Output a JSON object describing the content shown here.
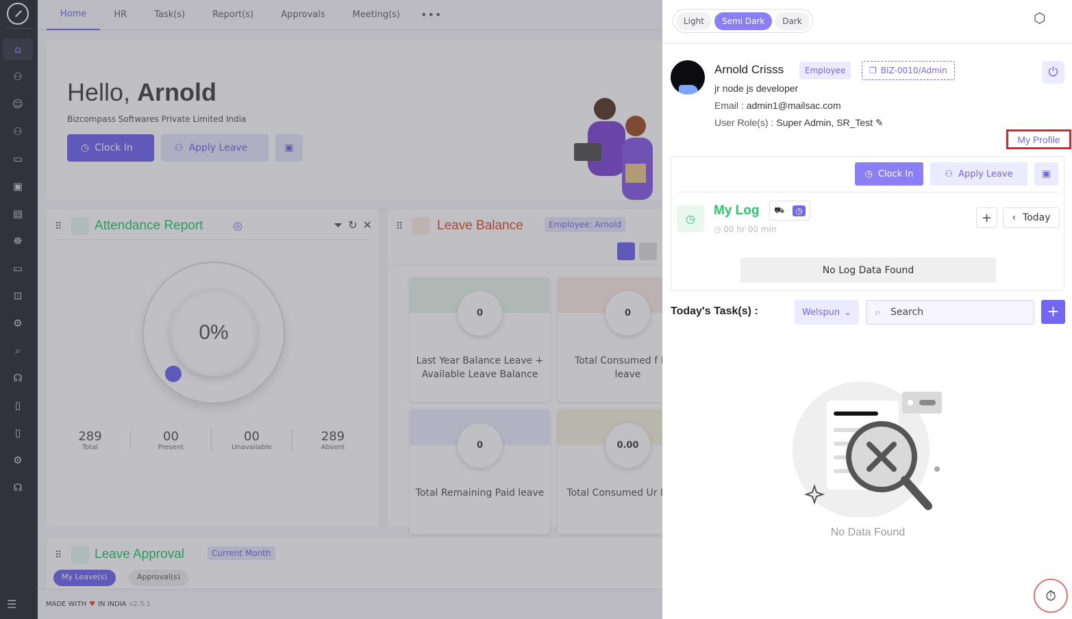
{
  "nav": {
    "tabs": [
      "Home",
      "HR",
      "Task(s)",
      "Report(s)",
      "Approvals",
      "Meeting(s)"
    ],
    "more": "•••"
  },
  "hero": {
    "hello_prefix": "Hello,",
    "hello_name": "Arnold",
    "company": "Bizcompass Softwares Private Limited India",
    "clock_in": "Clock In",
    "apply_leave": "Apply Leave"
  },
  "attendance": {
    "title": "Attendance Report",
    "percent": "0%",
    "stats": [
      {
        "value": "289",
        "label": "Total"
      },
      {
        "value": "00",
        "label": "Present"
      },
      {
        "value": "00",
        "label": "Unavailable"
      },
      {
        "value": "289",
        "label": "Absent"
      }
    ]
  },
  "leave_balance": {
    "title": "Leave Balance",
    "badge": "Employee: Arnold",
    "tiles": [
      {
        "value": "0",
        "label": "Last Year Balance Leave + Available Leave Balance",
        "color": "#e8f3ea"
      },
      {
        "value": "0",
        "label": "Total Consumed f Paid leave",
        "color": "#fbe9e4"
      },
      {
        "value": "0",
        "label": "Total Remaining Paid leave",
        "color": "#ecebfc"
      },
      {
        "value": "0.00",
        "label": "Total Consumed Ur Leave",
        "color": "#f5f1dd"
      }
    ]
  },
  "leave_approval": {
    "title": "Leave Approval",
    "badge": "Current Month",
    "pills": [
      "My Leave(s)",
      "Approval(s)"
    ]
  },
  "footer": {
    "made_with": "MADE WITH",
    "in_india": "IN INDIA",
    "version": "v2.5.1"
  },
  "drawer": {
    "themes": [
      "Light",
      "Semi Dark",
      "Dark"
    ],
    "theme_selected": "Semi Dark",
    "profile": {
      "name": "Arnold Crisss",
      "badge": "Employee",
      "code": "BIZ-0010/Admin",
      "designation": "jr node js developer",
      "email_label": "Email :",
      "email": "admin1@mailsac.com",
      "roles_label": "User Role(s) :",
      "roles": "Super Admin, SR_Test",
      "my_profile": "My Profile"
    },
    "log": {
      "clock_in": "Clock In",
      "apply_leave": "Apply Leave",
      "title": "My Log",
      "duration": "00 hr 00 min",
      "today": "Today",
      "empty": "No Log Data Found"
    },
    "tasks": {
      "label": "Today's Task(s) :",
      "company": "Welspun",
      "search_placeholder": "Search",
      "empty": "No Data Found"
    }
  },
  "colors": {
    "accent": "#7367f0",
    "green": "#28c76f",
    "orange": "#e04e2a",
    "highlight": "#e0202a"
  }
}
